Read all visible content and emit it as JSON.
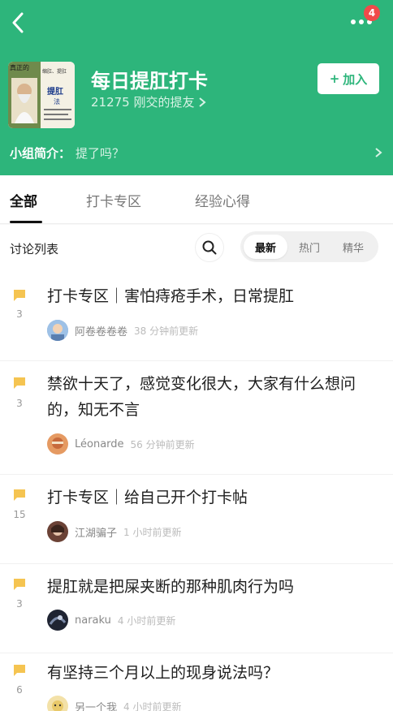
{
  "header": {
    "back_icon": "chevron-left-icon",
    "more_icon": "more-dots-icon",
    "notification_count": "4",
    "group_title": "每日提肛打卡",
    "member_count_text": "21275 刚交的提友",
    "join_label": "加入",
    "join_plus": "+",
    "intro_label": "小组简介：",
    "intro_text": "提了吗？",
    "cover_lines": [
      "真正的",
      "缩肛、提肛",
      "提肛",
      "法"
    ]
  },
  "tabs": [
    {
      "label": "全部",
      "active": true
    },
    {
      "label": "打卡专区",
      "active": false
    },
    {
      "label": "经验心得",
      "active": false
    }
  ],
  "list_toolbar": {
    "title": "讨论列表",
    "sort_options": [
      {
        "label": "最新",
        "active": true
      },
      {
        "label": "热门",
        "active": false
      },
      {
        "label": "精华",
        "active": false
      }
    ]
  },
  "posts": [
    {
      "title": "打卡专区｜害怕痔疮手术，日常提肛",
      "count": "3",
      "author": "阿卷卷卷卷",
      "time": "38 分钟前更新",
      "avatar_color": "#7aa6d8"
    },
    {
      "title": "禁欲十天了，感觉变化很大，大家有什么想问的，知无不言",
      "count": "3",
      "author": "Léonarde",
      "time": "56 分钟前更新",
      "avatar_color": "#d07b4f"
    },
    {
      "title": "打卡专区｜给自己开个打卡帖",
      "count": "15",
      "author": "江湖骗子",
      "time": "1 小时前更新",
      "avatar_color": "#8a5c4a"
    },
    {
      "title": "提肛就是把屎夹断的那种肌肉行为吗",
      "count": "3",
      "author": "naraku",
      "time": "4 小时前更新",
      "avatar_color": "#222838"
    },
    {
      "title": "有坚持三个月以上的现身说法吗？",
      "count": "6",
      "author": "另一个我",
      "time": "4 小时前更新",
      "avatar_color": "#e8c96a"
    }
  ],
  "colors": {
    "brand_green": "#2db57b",
    "flag_yellow": "#f5c451",
    "badge_red": "#f04a4a"
  }
}
